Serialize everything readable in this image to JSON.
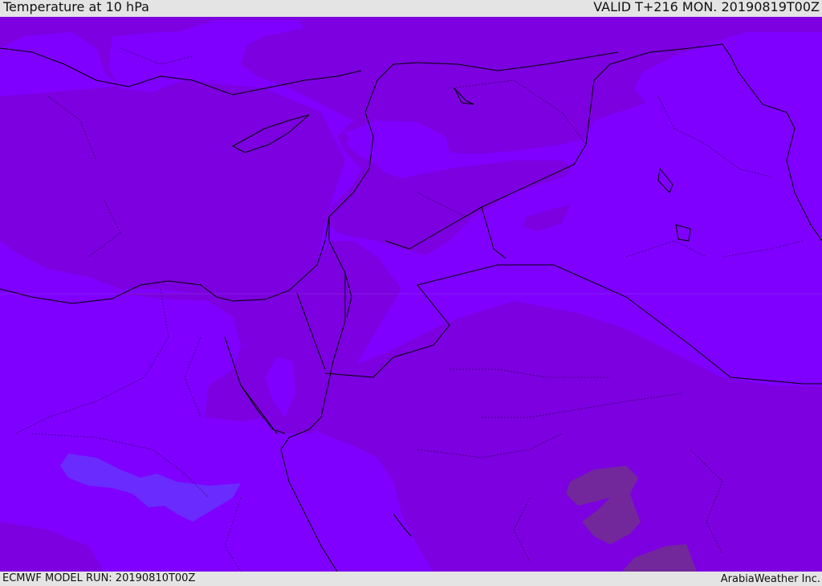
{
  "header": {
    "title": "Temperature at 10 hPa",
    "valid": "VALID T+216 MON. 20190819T00Z"
  },
  "footer": {
    "model_run": "ECMWF MODEL RUN: 20190810T00Z",
    "credit": "ArabiaWeather Inc."
  },
  "colors": {
    "band_warm": "#7c00e0",
    "band_cool": "#7f00ff",
    "band_coldest": "#6a2bff",
    "band_warmest": "#72289a",
    "border_line": "#000000"
  }
}
